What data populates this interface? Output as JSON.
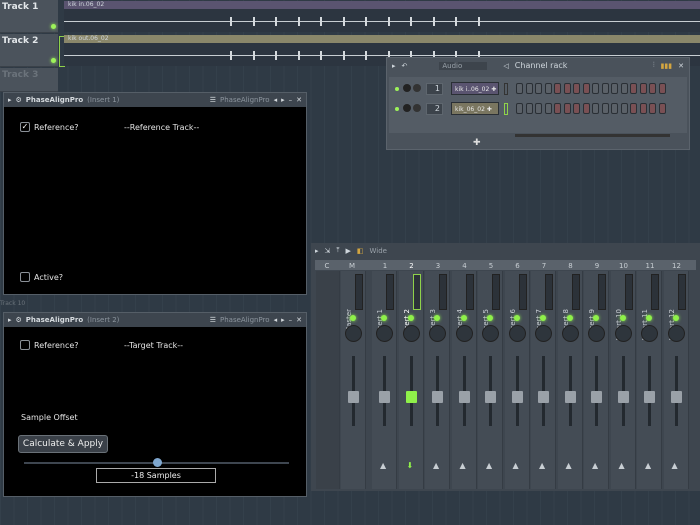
{
  "playlist": {
    "tracks": [
      {
        "name": "Track 1",
        "clip": "kik in.06_02",
        "clip_color": "#5a5470"
      },
      {
        "name": "Track 2",
        "clip": "kik out.06_02",
        "clip_color": "#8a876a"
      },
      {
        "name": "Track 3"
      }
    ],
    "hidden_track": "Track 10"
  },
  "plugin1": {
    "title": "PhaseAlignPro",
    "insert": "(Insert 1)",
    "preset": "PhaseAlignPro",
    "reference_label": "Reference?",
    "reference_checked": true,
    "track_label": "--Reference Track--",
    "active_label": "Active?"
  },
  "plugin2": {
    "title": "PhaseAlignPro",
    "insert": "(Insert 2)",
    "preset": "PhaseAlignPro",
    "reference_label": "Reference?",
    "reference_checked": false,
    "track_label": "--Target Track--",
    "offset_label": "Sample Offset",
    "button": "Calculate & Apply",
    "slider_value": 0.5,
    "value_display": "-18 Samples"
  },
  "rack": {
    "filter": "Audio",
    "title": "Channel rack",
    "channels": [
      {
        "num": "1",
        "name": "kik i..06_02",
        "color": "#5a5470"
      },
      {
        "num": "2",
        "name": "kik_06_02",
        "color": "#7a7660"
      }
    ]
  },
  "mixer": {
    "view": "Wide",
    "header": [
      "C",
      "M"
    ],
    "master": "Master",
    "inserts": [
      "Insert 1",
      "Insert 2",
      "Insert 3",
      "Insert 4",
      "Insert 5",
      "Insert 6",
      "Insert 7",
      "Insert 8",
      "Insert 9",
      "Insert 10",
      "Insert 11",
      "Insert 12"
    ],
    "numbers": [
      "1",
      "2",
      "3",
      "4",
      "5",
      "6",
      "7",
      "8",
      "9",
      "10",
      "11",
      "12"
    ],
    "selected": 2
  }
}
